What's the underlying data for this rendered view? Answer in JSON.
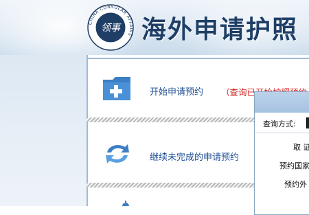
{
  "header": {
    "title": "海外申请护照",
    "logo_ring_text": "CHINA CONSULAR AFFAIRS",
    "logo_mark": "领事"
  },
  "options": [
    {
      "label": "开始申请预约",
      "icon": "folder-add-icon",
      "link": "（查询已开始护照预约"
    },
    {
      "label": "继续未完成的申请预约",
      "icon": "refresh-arrows-icon"
    }
  ],
  "popup": {
    "query_method_label": "查询方式:",
    "row1": "取 证",
    "row2": "预约国家",
    "row3": "预约外"
  },
  "colors": {
    "title": "#1f3e66",
    "label": "#1f4f96",
    "link": "#d42020",
    "accent": "#3a7fc4"
  }
}
